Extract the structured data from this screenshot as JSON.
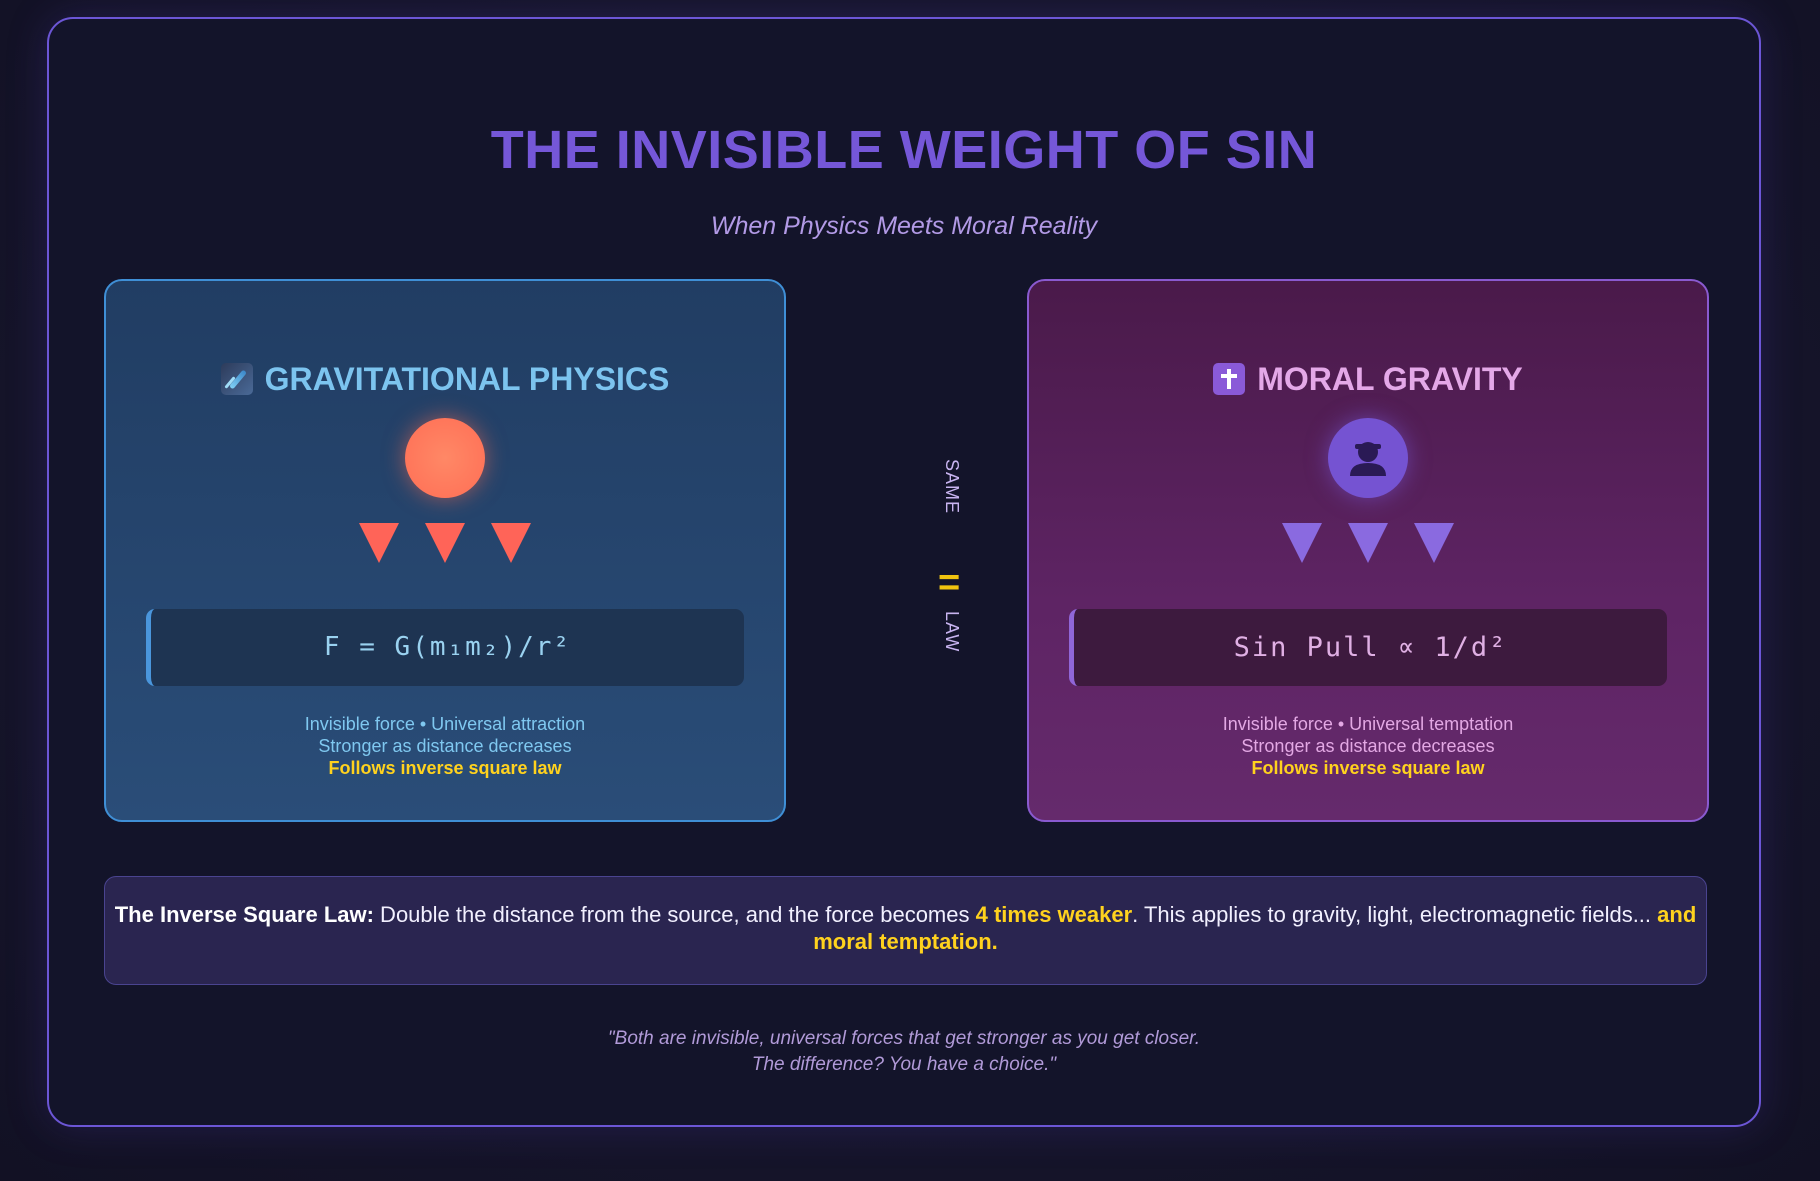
{
  "title": "THE INVISIBLE WEIGHT OF SIN",
  "subtitle": "When Physics Meets Moral Reality",
  "left_panel": {
    "icon": "comet-icon",
    "heading": "GRAVITATIONAL PHYSICS",
    "formula": "F = G(m₁m₂)/r²",
    "desc_line1": "Invisible force • Universal attraction",
    "desc_line2": "Stronger as distance decreases",
    "desc_highlight": "Follows inverse square law"
  },
  "right_panel": {
    "icon": "cross-icon",
    "heading": "MORAL GRAVITY",
    "formula": "Sin Pull ∝ 1/d²",
    "desc_line1": "Invisible force • Universal temptation",
    "desc_line2": "Stronger as distance decreases",
    "desc_highlight": "Follows inverse square law"
  },
  "middle": {
    "top_word": "SAME",
    "symbol": "=",
    "bottom_word": "LAW"
  },
  "banner": {
    "lead": "The Inverse Square Law:",
    "part1": " Double the distance from the source, and the force becomes ",
    "highlight1": "4 times weaker",
    "part2": ". This applies to gravity, light, electromagnetic fields... ",
    "highlight2": "and moral temptation."
  },
  "quote": {
    "line1": "\"Both are invisible, universal forces that get stronger as you get closer.",
    "line2": "The difference? You have a choice.\""
  },
  "colors": {
    "title": "#7557d8",
    "physics_accent": "#7cc4ef",
    "moral_accent": "#e4a8e8",
    "highlight": "#ffd21e",
    "frame_border": "#6c56d6"
  }
}
